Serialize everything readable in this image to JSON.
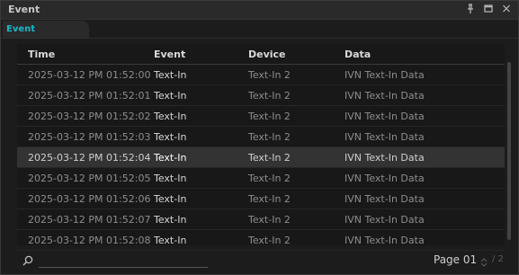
{
  "window": {
    "title": "Event"
  },
  "tabs": [
    {
      "label": "Event"
    }
  ],
  "table": {
    "headers": {
      "time": "Time",
      "event": "Event",
      "device": "Device",
      "data": "Data"
    },
    "rows": [
      {
        "time": "2025-03-12 PM 01:52:00",
        "event": "Text-In",
        "device": "Text-In 2",
        "data": "IVN Text-In Data"
      },
      {
        "time": "2025-03-12 PM 01:52:01",
        "event": "Text-In",
        "device": "Text-In 2",
        "data": "IVN Text-In Data"
      },
      {
        "time": "2025-03-12 PM 01:52:02",
        "event": "Text-In",
        "device": "Text-In 2",
        "data": "IVN Text-In Data"
      },
      {
        "time": "2025-03-12 PM 01:52:03",
        "event": "Text-In",
        "device": "Text-In 2",
        "data": "IVN Text-In Data"
      },
      {
        "time": "2025-03-12 PM 01:52:04",
        "event": "Text-In",
        "device": "Text-In 2",
        "data": "IVN Text-In Data"
      },
      {
        "time": "2025-03-12 PM 01:52:05",
        "event": "Text-In",
        "device": "Text-In 2",
        "data": "IVN Text-In Data"
      },
      {
        "time": "2025-03-12 PM 01:52:06",
        "event": "Text-In",
        "device": "Text-In 2",
        "data": "IVN Text-In Data"
      },
      {
        "time": "2025-03-12 PM 01:52:07",
        "event": "Text-In",
        "device": "Text-In 2",
        "data": "IVN Text-In Data"
      },
      {
        "time": "2025-03-12 PM 01:52:08",
        "event": "Text-In",
        "device": "Text-In 2",
        "data": "IVN Text-In Data"
      }
    ],
    "selected_row": 4
  },
  "footer": {
    "search": {
      "value": "",
      "placeholder": ""
    },
    "page_label": "Page 01",
    "page_total": "/ 2"
  },
  "icons": {
    "title_bar": [
      "pin-icon",
      "maximize-icon",
      "close-icon"
    ],
    "search": "search-icon",
    "pager": "spinner-icon"
  },
  "colors": {
    "tab_accent": "#18b8c8",
    "background": "#1b1b1b",
    "selected_row": "#333333"
  }
}
